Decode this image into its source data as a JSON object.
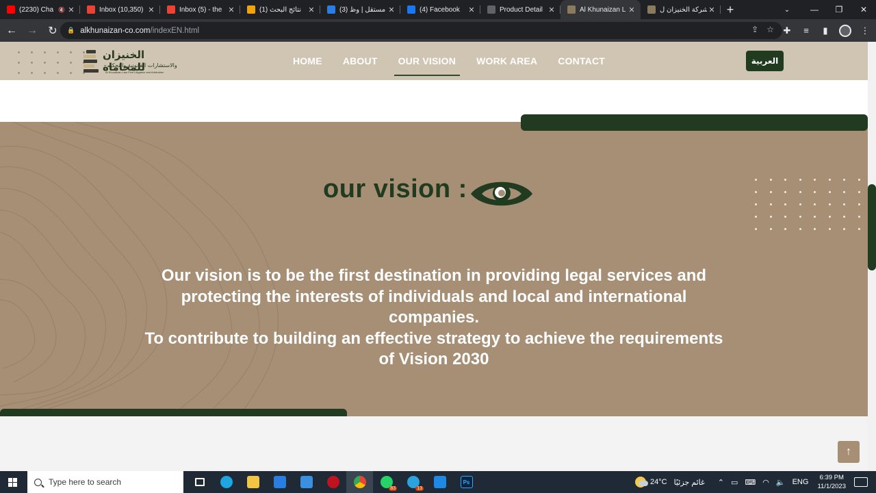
{
  "browser": {
    "tabs": [
      {
        "title": "(2230) Cha",
        "favicon": "youtube-icon",
        "color": "#ff0000",
        "muted": true
      },
      {
        "title": "Inbox (10,350)",
        "favicon": "gmail-icon",
        "color": "#ea4335"
      },
      {
        "title": "Inbox (5) - the",
        "favicon": "gmail-icon",
        "color": "#ea4335"
      },
      {
        "title": "(1) نتائج البحث",
        "favicon": "s-icon",
        "color": "#f0a30a"
      },
      {
        "title": "(3) مستقل | وظ",
        "favicon": "mostaql-icon",
        "color": "#2a7de1"
      },
      {
        "title": "(4) Facebook",
        "favicon": "facebook-icon",
        "color": "#1877f2"
      },
      {
        "title": "Product Detail",
        "favicon": "site-icon",
        "color": "#5f6368"
      },
      {
        "title": "Al Khunaizan L",
        "favicon": "site-icon",
        "color": "#8a7a5e",
        "active": true
      },
      {
        "title": "شركة الخنيزان ل",
        "favicon": "site-icon",
        "color": "#8a7a5e"
      }
    ],
    "url_host": "alkhunaizan-co.com",
    "url_path": "/indexEN.html"
  },
  "site": {
    "logo_ar": "الخنيزان للمحاماة",
    "logo_sub_ar": "والاستشارات القانونية والتحكيم",
    "logo_sub_en": "Al Khunaizan Law Firm Litigation and Arbitration",
    "nav": [
      {
        "label": "HOME"
      },
      {
        "label": "ABOUT"
      },
      {
        "label": "OUR VISION",
        "active": true
      },
      {
        "label": "WORK AREA"
      },
      {
        "label": "CONTACT"
      }
    ],
    "lang_button": "العربية",
    "colors": {
      "accent": "#203b1f",
      "section_bg": "#a68f75",
      "header_bg": "#cfc5b2"
    }
  },
  "vision": {
    "heading": "our vision :",
    "text_line_1": "Our vision is to be the first destination in providing legal services and protecting the interests of individuals and local and international companies.",
    "text_line_2": "To contribute to building an effective strategy to achieve the requirements of Vision 2030"
  },
  "taskbar": {
    "search_placeholder": "Type here to search",
    "weather_temp": "24°C",
    "weather_text": "غائم جزئيًا",
    "lang": "ENG",
    "time": "6:39 PM",
    "date": "11/1/2023",
    "whatsapp_badge": "83",
    "telegram_badge": "13"
  }
}
